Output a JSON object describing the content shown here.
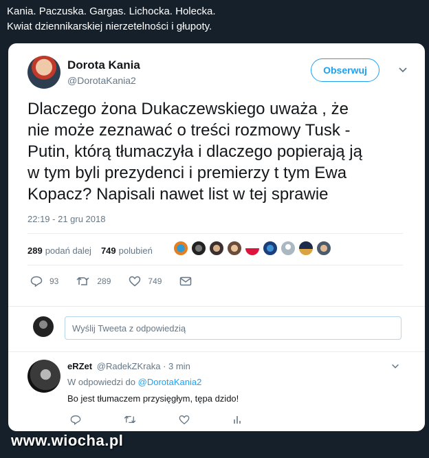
{
  "caption": {
    "line1": "Kania. Paczuska. Gargas. Lichocka. Holecka.",
    "line2": "Kwiat dziennikarskiej nierzetelności i głupoty."
  },
  "tweet": {
    "author_name": "Dorota Kania",
    "author_handle": "@DorotaKania2",
    "follow_label": "Obserwuj",
    "text_lines": [
      "Dlaczego żona Dukaczewskiego uważa , że",
      "nie może zeznawać o treści rozmowy Tusk -",
      "Putin, którą tłumaczyła i dlaczego popierają ją",
      "w tym byli prezydenci i premierzy t tym Ewa",
      "Kopacz? Napisali nawet list w tej sprawie"
    ],
    "timestamp": "22:19 - 21 gru 2018",
    "retweets_count": "289",
    "retweets_label": "podań dalej",
    "likes_count": "749",
    "likes_label": "polubień",
    "action_replies": "93",
    "action_retweets": "289",
    "action_likes": "749"
  },
  "reply_box": {
    "placeholder": "Wyślij Tweeta z odpowiedzią"
  },
  "reply": {
    "author_name": "eRZet",
    "author_handle": "@RadekZKraka",
    "time": "· 3 min",
    "reply_to_prefix": "W odpowiedzi do",
    "reply_to_handle": "@DorotaKania2",
    "text": "Bo jest tłumaczem przysięgłym, tępa dzido!"
  },
  "watermark": "www.wiocha.pl",
  "colors": {
    "background": "#15202b",
    "accent": "#1da1f2",
    "muted": "#657786"
  }
}
